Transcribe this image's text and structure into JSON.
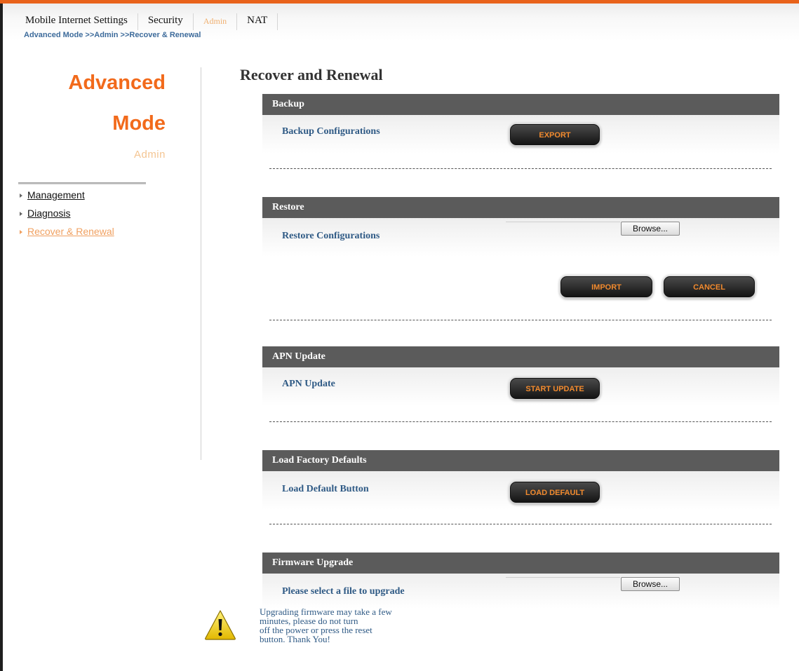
{
  "tabs": [
    {
      "label": "Mobile Internet Settings"
    },
    {
      "label": "Security"
    },
    {
      "label": "Admin"
    },
    {
      "label": "NAT"
    }
  ],
  "breadcrumb": "Advanced Mode >>Admin >>Recover & Renewal",
  "sidebar": {
    "title_line1": "Advanced",
    "title_line2": "Mode",
    "subtitle": "Admin",
    "items": [
      {
        "label": "Management"
      },
      {
        "label": "Diagnosis"
      },
      {
        "label": "Recover & Renewal",
        "active": true
      }
    ]
  },
  "main": {
    "title": "Recover and Renewal",
    "backup": {
      "header": "Backup",
      "label": "Backup Configurations",
      "button": "EXPORT"
    },
    "restore": {
      "header": "Restore",
      "label": "Restore Configurations",
      "browse": "Browse...",
      "import": "IMPORT",
      "cancel": "CANCEL"
    },
    "apn": {
      "header": "APN Update",
      "label": "APN Update",
      "button": "START UPDATE"
    },
    "factory": {
      "header": "Load Factory Defaults",
      "label": "Load Default Button",
      "button": "LOAD DEFAULT"
    },
    "firmware": {
      "header": "Firmware Upgrade",
      "label": "Please select a file to upgrade",
      "browse": "Browse...",
      "warning_lines": [
        "Upgrading firmware may take a few",
        "minutes, please do not turn",
        "off the power or press the reset",
        "button. Thank You!"
      ]
    }
  },
  "colors": {
    "accent": "#f26a1b",
    "section_header": "#5b5b5b",
    "label": "#2f5a85",
    "button_text": "#f18a2e"
  },
  "icons": {
    "warning": "warning-triangle-icon",
    "bullet": "triangle-bullet-icon"
  }
}
